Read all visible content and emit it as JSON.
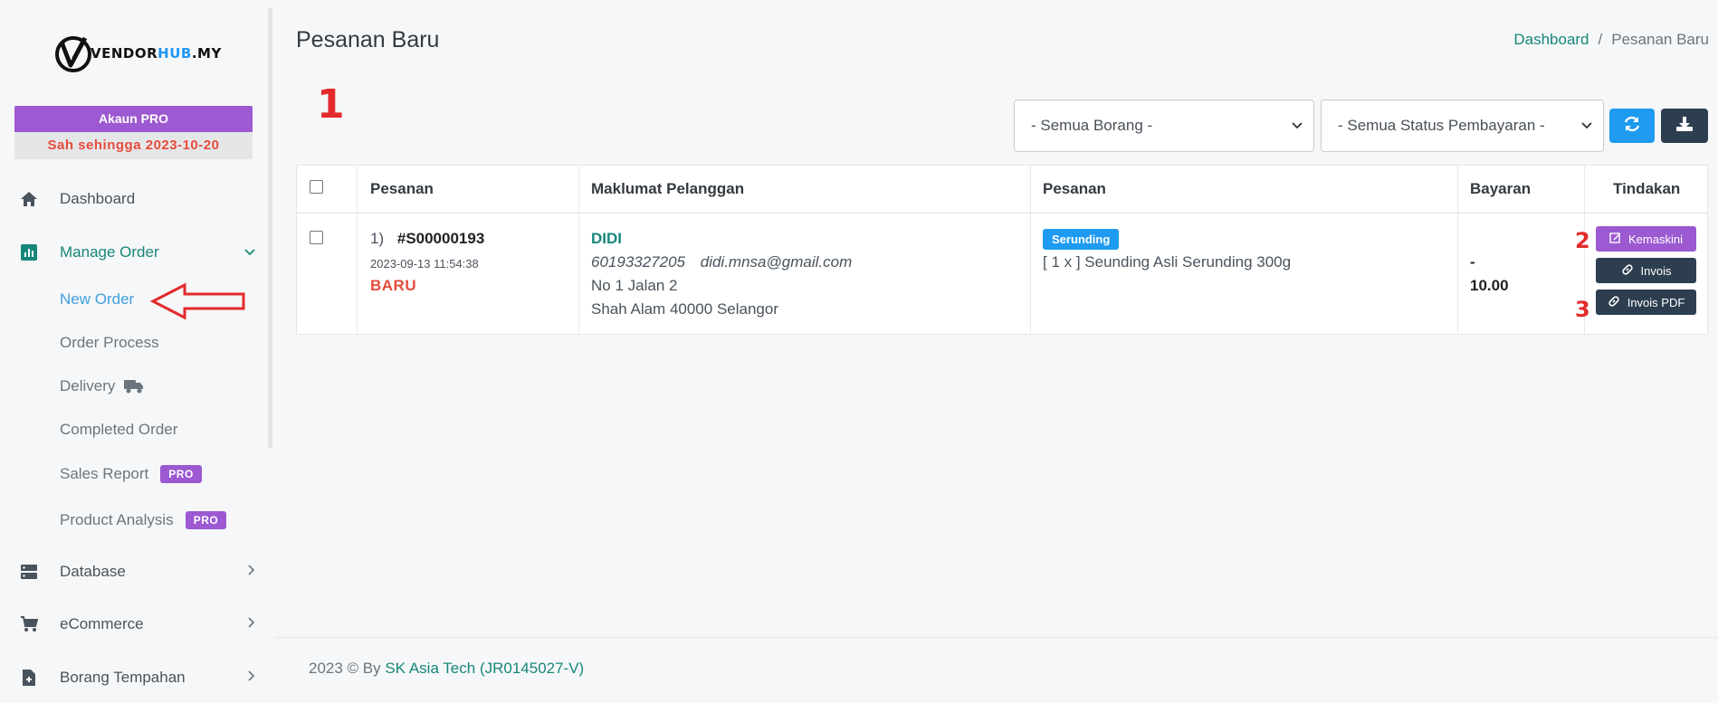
{
  "sidebar": {
    "logo": {
      "part1": "VENDOR",
      "part2": "HUB",
      "part3": ".MY"
    },
    "pro": {
      "title": "Akaun PRO",
      "valid": "Sah sehingga 2023-10-20"
    },
    "dashboard": "Dashboard",
    "manage_order": "Manage Order",
    "sub": {
      "new_order": "New Order",
      "order_process": "Order Process",
      "delivery": "Delivery",
      "completed": "Completed Order",
      "sales_report": "Sales Report",
      "product_analysis": "Product Analysis",
      "pro_badge": "PRO"
    },
    "database": "Database",
    "ecommerce": "eCommerce",
    "borang": "Borang Tempahan"
  },
  "header": {
    "title": "Pesanan Baru",
    "breadcrumb": {
      "home": "Dashboard",
      "sep": "/",
      "current": "Pesanan Baru"
    }
  },
  "markers": {
    "m1": "1",
    "m2": "2",
    "m3": "3"
  },
  "filters": {
    "form_select": "- Semua Borang -",
    "payment_select": "- Semua Status Pembayaran -"
  },
  "table": {
    "headers": {
      "order": "Pesanan",
      "customer": "Maklumat Pelanggan",
      "items": "Pesanan",
      "payment": "Bayaran",
      "action": "Tindakan"
    },
    "row": {
      "index": "1)",
      "order_id": "#S00000193",
      "date": "2023-09-13 11:54:38",
      "status": "BARU",
      "cust_name": "DIDI",
      "cust_phone": "60193327205",
      "cust_email": "didi.mnsa@gmail.com",
      "cust_addr1": "No 1 Jalan 2",
      "cust_addr2": "Shah Alam 40000 Selangor",
      "form_badge": "Serunding",
      "item_line": "[ 1 x ] Seunding Asli Serunding 300g",
      "pay_dash": "-",
      "pay_amount": "10.00",
      "btn_edit": "Kemaskini",
      "btn_invoice": "Invois",
      "btn_invoice_pdf": "Invois PDF"
    }
  },
  "footer": {
    "text": "2023 © By ",
    "company": "SK Asia Tech (JR0145027-V)"
  }
}
